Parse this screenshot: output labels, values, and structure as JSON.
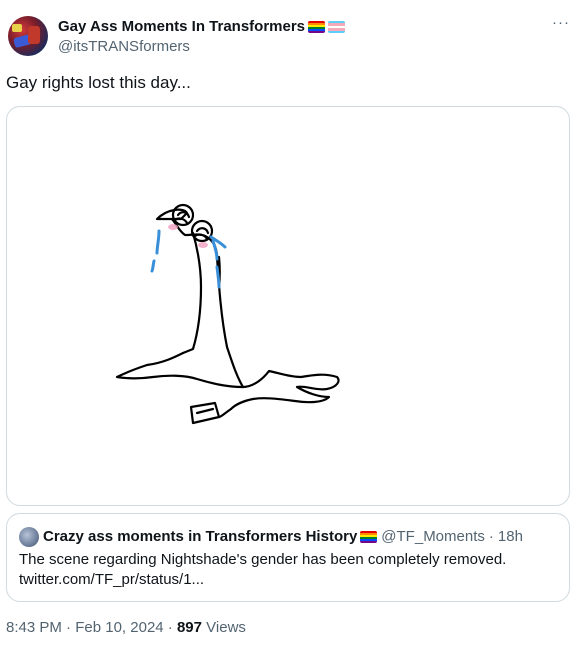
{
  "author": {
    "name": "Gay Ass Moments In Transformers",
    "handle": "@itsTRANSformers"
  },
  "flags": {
    "rainbow": [
      "#e40303",
      "#ff8c00",
      "#ffed00",
      "#008026",
      "#004dff",
      "#750787"
    ],
    "trans": [
      "#5bcefa",
      "#f5a9b8",
      "#ffffff",
      "#f5a9b8",
      "#5bcefa"
    ]
  },
  "more_label": "···",
  "tweet": {
    "text": "Gay rights lost this day..."
  },
  "media": {
    "icon": "drawing-image",
    "ink_color": "#000000",
    "tear_color": "#3a8fd9",
    "blush_color": "#f0a0c0"
  },
  "quote": {
    "name": "Crazy ass moments in Transformers History",
    "handle": "@TF_Moments",
    "separator": "·",
    "time": "18h",
    "text_line1": "The scene regarding Nightshade's gender has been completely removed.",
    "text_line2": "twitter.com/TF_pr/status/1..."
  },
  "footer": {
    "time": "8:43 PM",
    "separator1": "·",
    "date": "Feb 10, 2024",
    "separator2": "·",
    "views_count": "897",
    "views_label": "Views"
  },
  "colors": {
    "text_primary": "#0f1419",
    "text_secondary": "#536471",
    "border": "#cfd9de"
  }
}
